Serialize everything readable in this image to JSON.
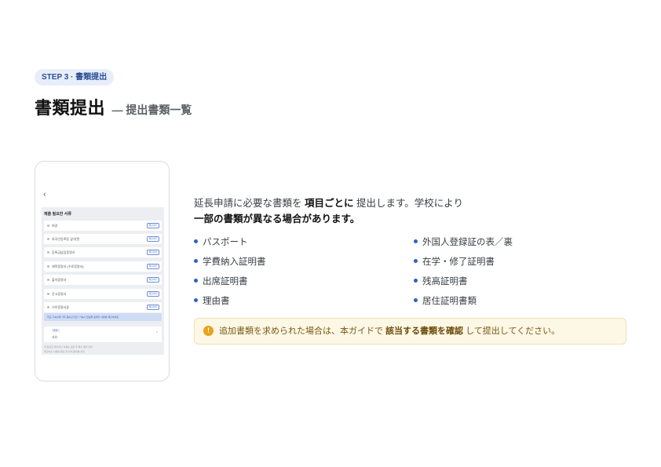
{
  "step_badge": "STEP 3 · 書類提出",
  "heading": {
    "main": "書類提出",
    "sub": "— 提出書類一覧"
  },
  "phone": {
    "back_icon": "chevron-left-icon",
    "screen_title": "제출 필요한 서류",
    "rows": [
      {
        "label": "여권",
        "button": "제출하기"
      },
      {
        "label": "외국인등록증 앞/뒷면",
        "button": "제출하기"
      },
      {
        "label": "등록금납입증명서",
        "button": "제출하기"
      },
      {
        "label": "재학증명서 (수료증명서)",
        "button": "제출하기"
      },
      {
        "label": "출석증명서",
        "button": "제출하기"
      },
      {
        "label": "잔고증명서",
        "button": "제출하기"
      },
      {
        "label": "거주증명서류",
        "button": "제출하기"
      }
    ],
    "note": "학교 기숙사에 거주 중이신가요? 기숙사 입실을 증명할 서류를 제출하세요.",
    "card": {
      "tag": "추가",
      "label": "사유"
    },
    "footer_line1": "첨 필요한 제출하신 서류는 검토 후 확인 결과 안내",
    "footer_line2": "제출하신 서류를 확인 후 처리 결과를 안내"
  },
  "intro": {
    "part1": "延長申請に必要な書類を",
    "bold1": "項目ごとに",
    "part2": "提出します。学校により",
    "bold2": "一部の書類が異なる場合があります。"
  },
  "documents_left": [
    "パスポート",
    "学費納入証明書",
    "出席証明書",
    "理由書"
  ],
  "documents_right": [
    "外国人登録証の表／裏",
    "在学・修了証明書",
    "残高証明書",
    "居住証明書類"
  ],
  "notice": {
    "icon": "exclamation-icon",
    "text1": "追加書類を求められた場合は、本ガイドで",
    "bold": "該当する書類を確認",
    "text2": "して提出してください。"
  },
  "colors": {
    "accent": "#2a64c4",
    "badge_bg": "#e8eef9",
    "notice_bg": "#fdf7e6",
    "notice_icon": "#e9a21a"
  }
}
